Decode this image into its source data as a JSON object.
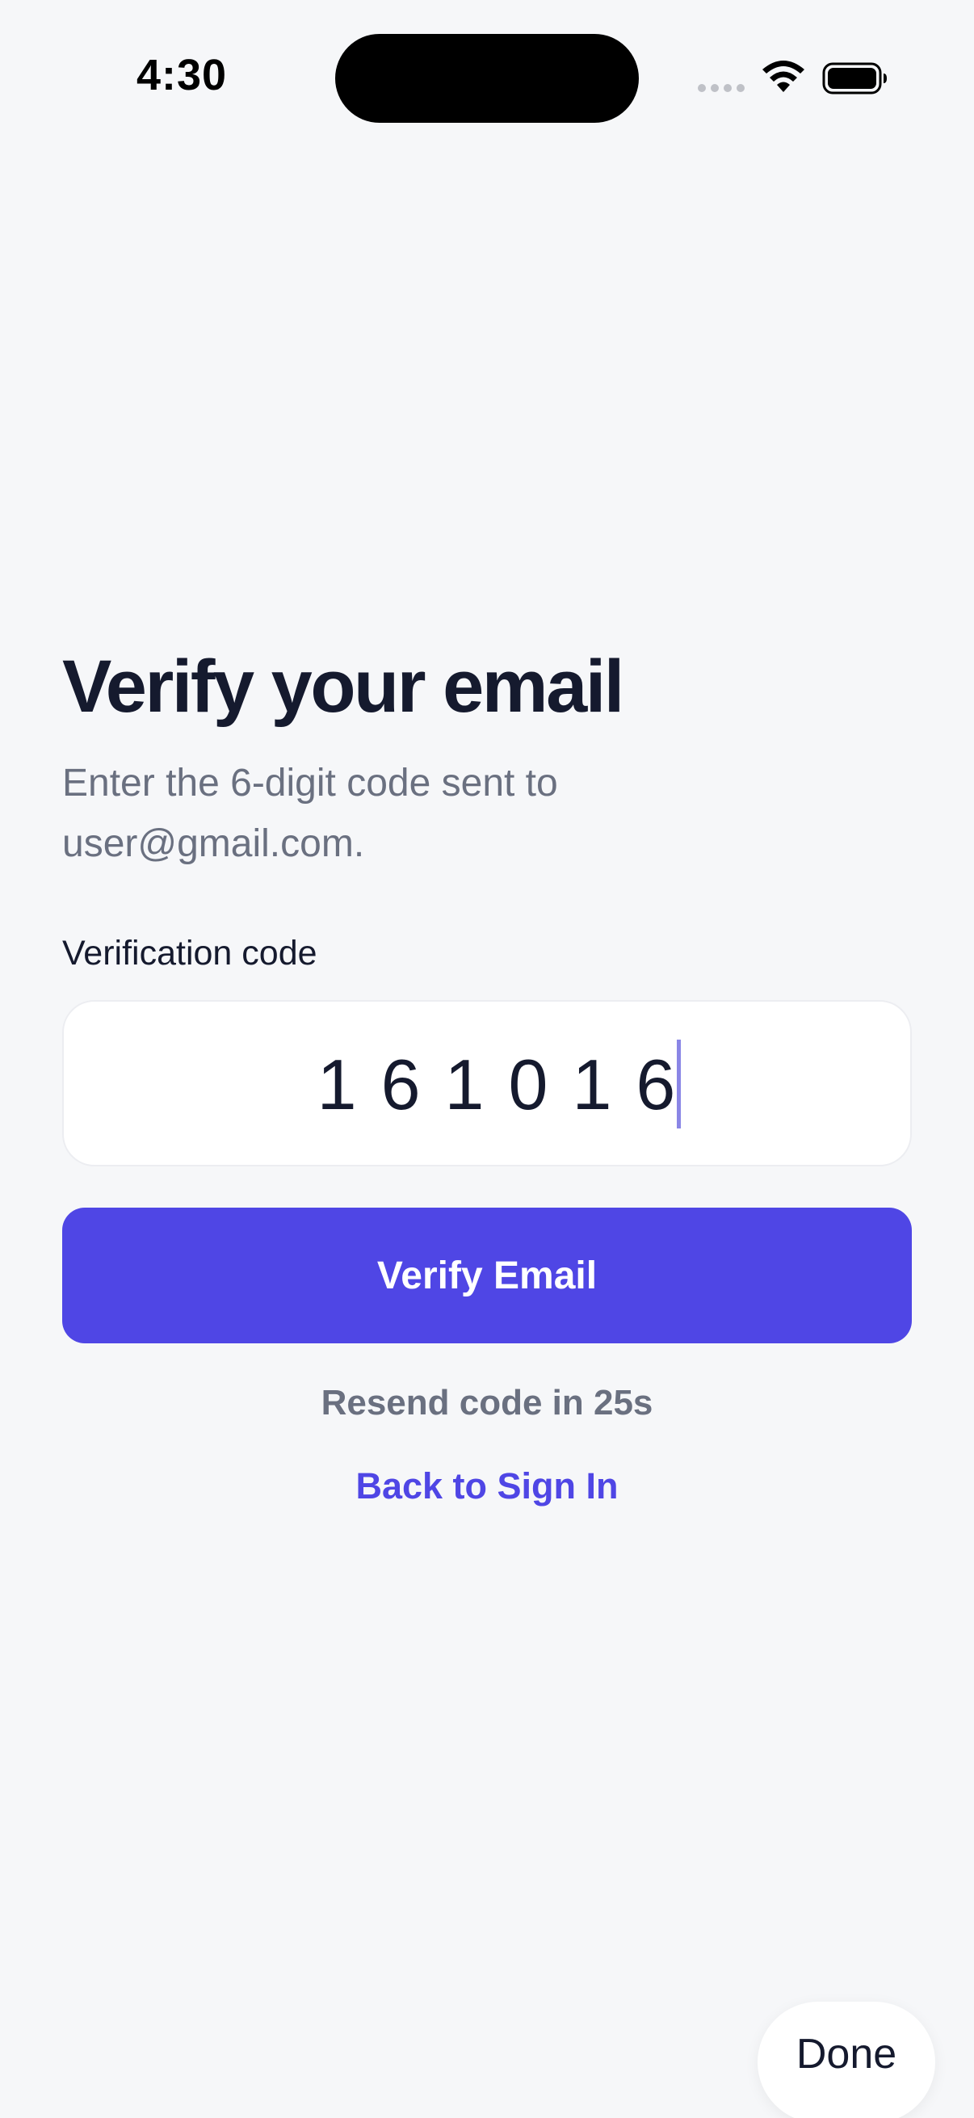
{
  "status_bar": {
    "time": "4:30",
    "icons": [
      "cellular-signal-icon",
      "wifi-icon",
      "battery-icon"
    ]
  },
  "screen": {
    "title": "Verify your email",
    "subtitle": "Enter the 6-digit code sent to user@gmail.com.",
    "code_field": {
      "label": "Verification code",
      "value": "161016"
    },
    "verify_button": {
      "label": "Verify Email"
    },
    "resend_text": "Resend code in 25s",
    "back_link": "Back to Sign In"
  },
  "keyboard_accessory": {
    "done_label": "Done"
  },
  "colors": {
    "background": "#F6F7F9",
    "primary": "#4F46E5",
    "text_dark": "#151A2E",
    "text_muted": "#6A7080",
    "caret": "#8A86E6"
  }
}
